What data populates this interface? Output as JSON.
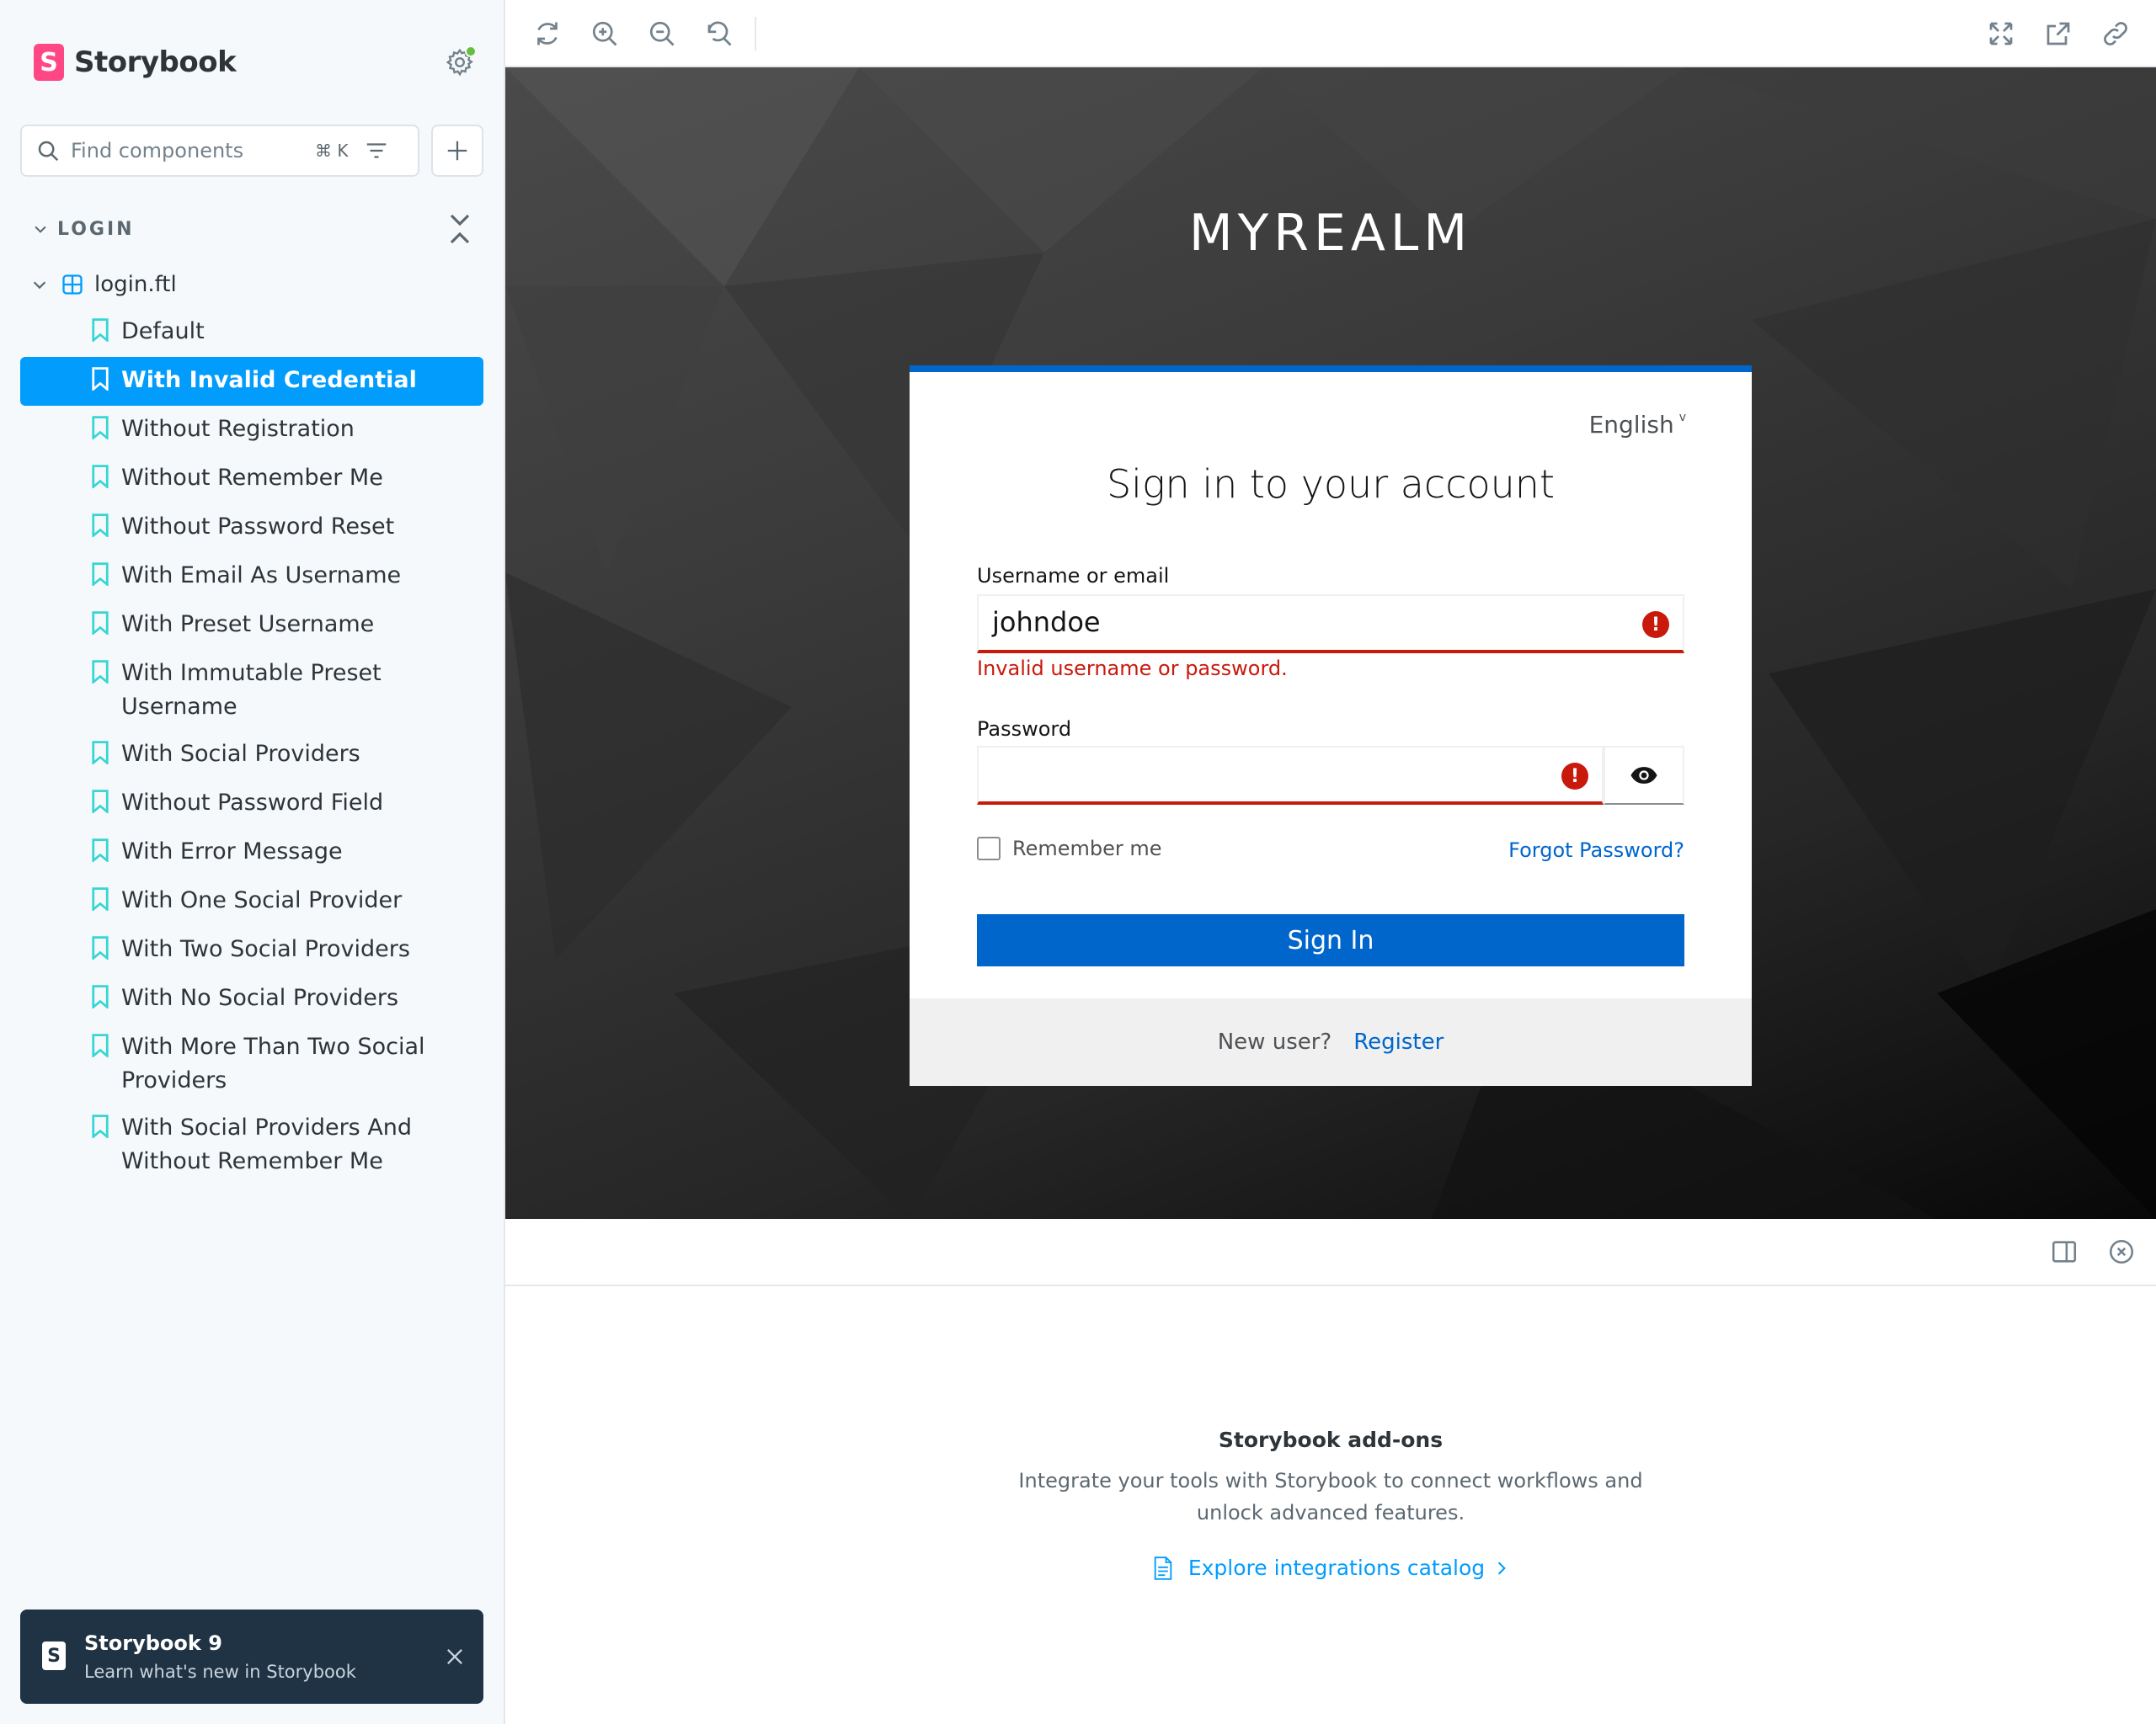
{
  "sidebar": {
    "brand": "Storybook",
    "search": {
      "placeholder": "Find components",
      "shortcut": "⌘ K"
    },
    "group": "LOGIN",
    "component": "login.ftl",
    "stories": [
      {
        "label": "Default",
        "active": false
      },
      {
        "label": "With Invalid Credential",
        "active": true
      },
      {
        "label": "Without Registration",
        "active": false
      },
      {
        "label": "Without Remember Me",
        "active": false
      },
      {
        "label": "Without Password Reset",
        "active": false
      },
      {
        "label": "With Email As Username",
        "active": false
      },
      {
        "label": "With Preset Username",
        "active": false
      },
      {
        "label": "With Immutable Preset Username",
        "active": false
      },
      {
        "label": "With Social Providers",
        "active": false
      },
      {
        "label": "Without Password Field",
        "active": false
      },
      {
        "label": "With Error Message",
        "active": false
      },
      {
        "label": "With One Social Provider",
        "active": false
      },
      {
        "label": "With Two Social Providers",
        "active": false
      },
      {
        "label": "With No Social Providers",
        "active": false
      },
      {
        "label": "With More Than Two Social Providers",
        "active": false
      },
      {
        "label": "With Social Providers And Without Remember Me",
        "active": false
      }
    ],
    "toast": {
      "title": "Storybook 9",
      "subtitle": "Learn what's new in Storybook"
    }
  },
  "toolbar": {
    "left_icons": [
      "remount-icon",
      "zoom-in-icon",
      "zoom-out-icon",
      "reset-zoom-icon"
    ],
    "right_icons": [
      "fullscreen-icon",
      "open-new-tab-icon",
      "copy-link-icon"
    ]
  },
  "preview": {
    "realm": "MYREALM",
    "language": "English",
    "title": "Sign in to your account",
    "username_label": "Username or email",
    "username_value": "johndoe",
    "error": "Invalid username or password.",
    "password_label": "Password",
    "remember_label": "Remember me",
    "forgot_label": "Forgot Password?",
    "signin_label": "Sign In",
    "new_user": "New user?",
    "register": "Register"
  },
  "addons": {
    "title": "Storybook add-ons",
    "description": "Integrate your tools with Storybook to connect workflows and unlock advanced features.",
    "link": "Explore integrations catalog"
  },
  "colors": {
    "accent": "#029cfd",
    "brand": "#ff4785",
    "keycloak_blue": "#0066cc",
    "error_red": "#c9190b"
  }
}
